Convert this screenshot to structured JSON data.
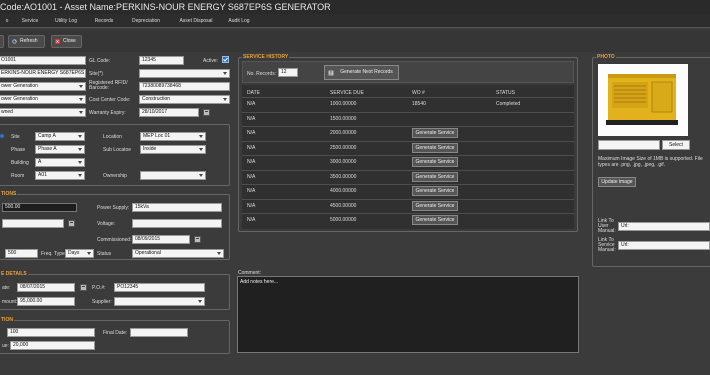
{
  "window": {
    "title": "Code:AO1001 - Asset Name:PERKINS-NOUR ENERGY S687EP6S GENERATOR"
  },
  "tabs": [
    "o",
    "Service",
    "Utility Log",
    "Records",
    "Depreciation",
    "Asset Disposal",
    "Audit Log"
  ],
  "toolbar": {
    "refresh": "Refresh",
    "close": "Close"
  },
  "general": {
    "asset_code": "O1001",
    "asset_name": "ERKINS-NOUR ENERGY S687EP6S GEN",
    "category1": "ower Generation",
    "category2": "ower Generation",
    "ownership_type": "wned",
    "gl_code_label": "GL Code:",
    "gl_code": "12345",
    "active_label": "Active:",
    "site_q_label": "Site(*)",
    "rfid_label": "Registered RFID/ Barcode:",
    "rfid": "72380089738468",
    "cost_center_label": "Cost Center Code:",
    "cost_center": "Construction",
    "warranty_label": "Warranty Expiry:",
    "warranty": "28/10/2017"
  },
  "location": {
    "site_label": "Site",
    "site": "Camp A",
    "location_label": "Location",
    "location": "MEP Loc 01",
    "phase_label": "Phase",
    "phase": "Phase A",
    "sublocation_label": "Sub Locatoe",
    "sublocation": "Inside",
    "building_label": "Building",
    "building": "A",
    "room_label": "Room",
    "room": "A01",
    "ownership_label": "Ownership",
    "ownership": ""
  },
  "specs": {
    "title": "TIONS",
    "value1": "500.00",
    "power_supply_label": "Power Supply:",
    "power_supply": "15kVa",
    "voltage_label": "Voltage:",
    "voltage": "",
    "commissioned_label": "Commissioned:",
    "commissioned": "08/09/2015",
    "freq_value": "500",
    "freq_type_label": "Freq. Type:",
    "freq_type": "Days",
    "status_label": "Status",
    "status": "Operational"
  },
  "purchase": {
    "title": "E DETAILS",
    "date_label": "ate:",
    "date": "08/07/2015",
    "po_label": "P.O.#:",
    "po": "PO12345",
    "amount_label": "mount:",
    "amount": "95,000.00",
    "supplier_label": "Supplier:",
    "supplier": ""
  },
  "depreciation": {
    "title": "TION",
    "value1": "100",
    "final_date_label": "Final Date:",
    "final_date": "",
    "value_label": "ue:",
    "value2": "20,000"
  },
  "service_history": {
    "title": "SERVICE HISTORY",
    "no_records_label": "No. Records:",
    "no_records": "12",
    "generate_next_label": "Generate Next Records",
    "columns": [
      "DATE",
      "SERVICE DUE",
      "WO #",
      "STATUS"
    ],
    "rows": [
      {
        "date": "N/A",
        "due": "1000.00000",
        "wo": "18540",
        "status": "Completed",
        "button": ""
      },
      {
        "date": "N/A",
        "due": "1500.00000",
        "wo": "",
        "status": "",
        "button": ""
      },
      {
        "date": "N/A",
        "due": "2000.00000",
        "wo": "",
        "status": "",
        "button": "Generate Service"
      },
      {
        "date": "N/A",
        "due": "2500.00000",
        "wo": "",
        "status": "",
        "button": "Generate Service"
      },
      {
        "date": "N/A",
        "due": "3000.00000",
        "wo": "",
        "status": "",
        "button": "Generate Service"
      },
      {
        "date": "N/A",
        "due": "3500.00000",
        "wo": "",
        "status": "",
        "button": "Generate Service"
      },
      {
        "date": "N/A",
        "due": "4000.00000",
        "wo": "",
        "status": "",
        "button": "Generate Service"
      },
      {
        "date": "N/A",
        "due": "4500.00000",
        "wo": "",
        "status": "",
        "button": "Generate Service"
      },
      {
        "date": "N/A",
        "due": "5000.00000",
        "wo": "",
        "status": "",
        "button": "Generate Service"
      }
    ]
  },
  "comment": {
    "label": "Comment:",
    "text": "Add notes here..."
  },
  "photo": {
    "title": "PHOTO",
    "select_label": "Select",
    "note": "Maximum Image Size of 1MB is supported. File types are .png, .jpg, .jpeg, .gif.",
    "update_label": "Update image",
    "user_manual_label": "Link To User Manual:",
    "user_manual": "Url:",
    "service_manual_label": "Link To Service Manual:",
    "service_manual": "Url:"
  },
  "colors": {
    "accent": "#e8a23a",
    "background": "#3b3b3b",
    "active_check": "#2f6fd0"
  }
}
